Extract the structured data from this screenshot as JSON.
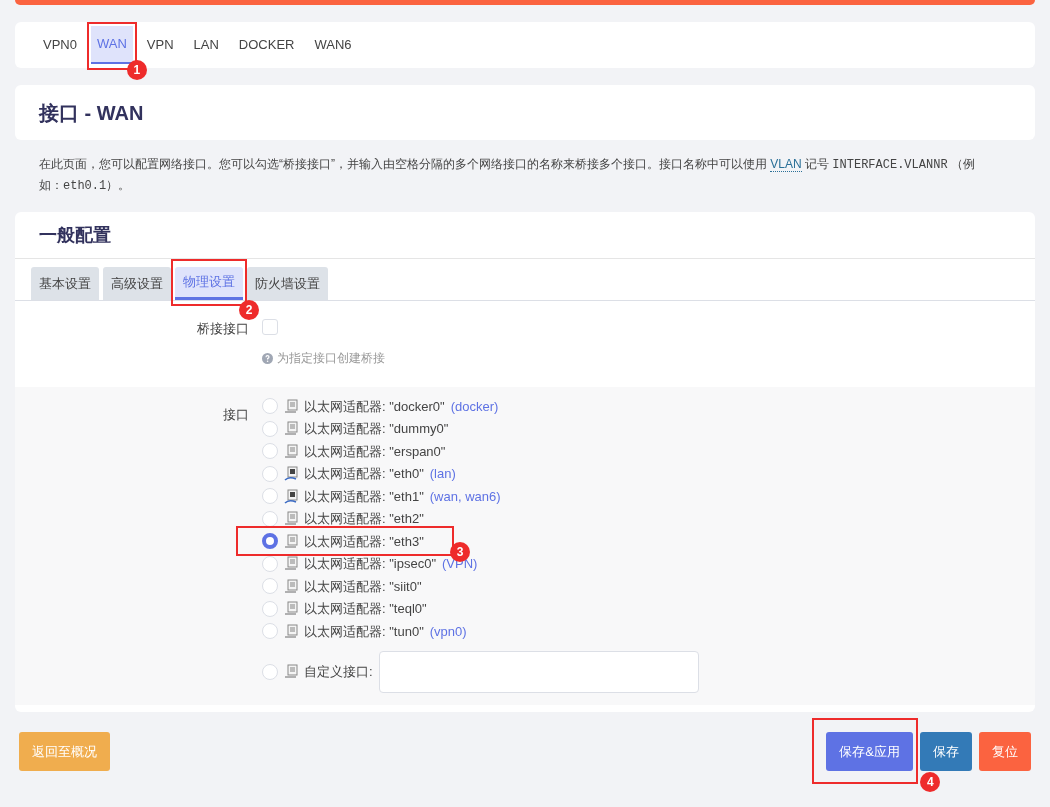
{
  "top_tabs": [
    {
      "label": "VPN0",
      "selected": false
    },
    {
      "label": "WAN",
      "selected": true,
      "annotation": "1"
    },
    {
      "label": "VPN",
      "selected": false
    },
    {
      "label": "LAN",
      "selected": false
    },
    {
      "label": "DOCKER",
      "selected": false
    },
    {
      "label": "WAN6",
      "selected": false
    }
  ],
  "page_title": "接口 - WAN",
  "description": [
    {
      "kind": "plain",
      "text": "在此页面，您可以配置网络接口。您可以勾选“桥接接口”，并输入由空格分隔的多个网络接口的名称来桥接多个接口。接口名称中可以使用 "
    },
    {
      "kind": "abbr",
      "text": "VLAN"
    },
    {
      "kind": "plain",
      "text": " 记号 "
    },
    {
      "kind": "code",
      "text": "INTERFACE.VLANNR"
    },
    {
      "kind": "plain",
      "text": " （例如："
    },
    {
      "kind": "code",
      "text": "eth0.1"
    },
    {
      "kind": "plain",
      "text": "）。"
    }
  ],
  "section": {
    "title": "一般配置",
    "tabs": [
      {
        "label": "基本设置",
        "selected": false
      },
      {
        "label": "高级设置",
        "selected": false
      },
      {
        "label": "物理设置",
        "selected": true,
        "annotation": "2"
      },
      {
        "label": "防火墙设置",
        "selected": false
      }
    ],
    "bridge": {
      "label": "桥接接口",
      "checked": false,
      "hint": "为指定接口创建桥接"
    },
    "interface": {
      "label": "接口",
      "options": [
        {
          "kind": "adapter",
          "text": "以太网适配器: \"docker0\"",
          "network": "(docker)",
          "selected": false,
          "linked": false
        },
        {
          "kind": "adapter",
          "text": "以太网适配器: \"dummy0\"",
          "selected": false,
          "linked": false
        },
        {
          "kind": "adapter",
          "text": "以太网适配器: \"erspan0\"",
          "selected": false,
          "linked": false
        },
        {
          "kind": "adapter",
          "text": "以太网适配器: \"eth0\"",
          "network": "(lan)",
          "selected": false,
          "linked": true
        },
        {
          "kind": "adapter",
          "text": "以太网适配器: \"eth1\"",
          "network": "(wan, wan6)",
          "selected": false,
          "linked": true
        },
        {
          "kind": "adapter",
          "text": "以太网适配器: \"eth2\"",
          "selected": false,
          "linked": false
        },
        {
          "kind": "adapter",
          "text": "以太网适配器: \"eth3\"",
          "selected": true,
          "linked": false,
          "annotation": "3"
        },
        {
          "kind": "adapter",
          "text": "以太网适配器: \"ipsec0\"",
          "network": "(VPN)",
          "selected": false,
          "linked": false
        },
        {
          "kind": "adapter",
          "text": "以太网适配器: \"siit0\"",
          "selected": false,
          "linked": false
        },
        {
          "kind": "adapter",
          "text": "以太网适配器: \"teql0\"",
          "selected": false,
          "linked": false
        },
        {
          "kind": "adapter",
          "text": "以太网适配器: \"tun0\"",
          "network": "(vpn0)",
          "selected": false,
          "linked": false
        },
        {
          "kind": "custom",
          "text": "自定义接口:",
          "selected": false,
          "linked": false
        }
      ]
    }
  },
  "buttons": [
    {
      "kind": "back",
      "label": "返回至概况"
    },
    {
      "kind": "apply",
      "label": "保存&应用",
      "annotation": "4"
    },
    {
      "kind": "save",
      "label": "保存"
    },
    {
      "kind": "reset",
      "label": "复位"
    }
  ]
}
